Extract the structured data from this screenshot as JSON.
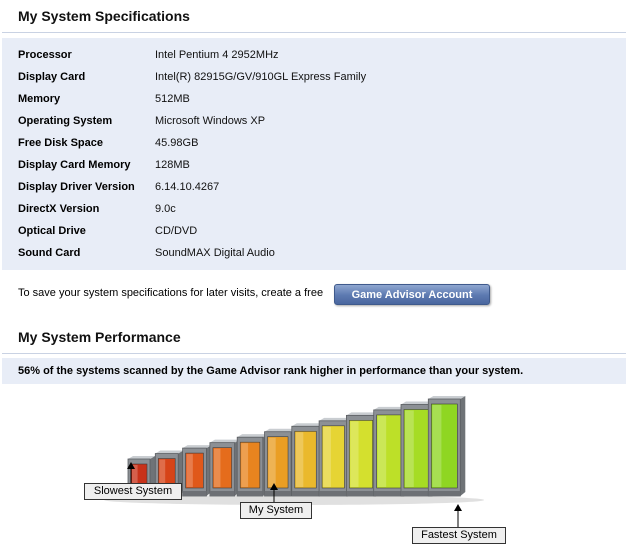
{
  "specs": {
    "title": "My System Specifications",
    "rows": [
      {
        "label": "Processor",
        "value": "Intel Pentium 4 2952MHz"
      },
      {
        "label": "Display Card",
        "value": "Intel(R) 82915G/GV/910GL Express Family"
      },
      {
        "label": "Memory",
        "value": "512MB"
      },
      {
        "label": "Operating System",
        "value": "Microsoft Windows XP"
      },
      {
        "label": "Free Disk Space",
        "value": "45.98GB"
      },
      {
        "label": "Display Card Memory",
        "value": "128MB"
      },
      {
        "label": "Display Driver Version",
        "value": "6.14.10.4267"
      },
      {
        "label": "DirectX Version",
        "value": "9.0c"
      },
      {
        "label": "Optical Drive",
        "value": "CD/DVD"
      },
      {
        "label": "Sound Card",
        "value": "SoundMAX Digital Audio"
      }
    ]
  },
  "save": {
    "text": "To save your system specifications for later visits, create a free",
    "button_label": "Game Advisor Account"
  },
  "performance": {
    "title": "My System Performance",
    "rank_text": "56% of the systems scanned by the Game Advisor rank higher in performance than your system.",
    "percent_higher": 56,
    "bar_count": 12,
    "my_system_index": 5,
    "colors": [
      "#c8321a",
      "#d64418",
      "#e0581a",
      "#e56c1c",
      "#e8841f",
      "#ea9e24",
      "#eab92c",
      "#e6d434",
      "#d4e02e",
      "#bde028",
      "#a6dc24",
      "#8fd622"
    ],
    "labels": {
      "slowest": "Slowest System",
      "mine": "My System",
      "fastest": "Fastest System"
    }
  }
}
